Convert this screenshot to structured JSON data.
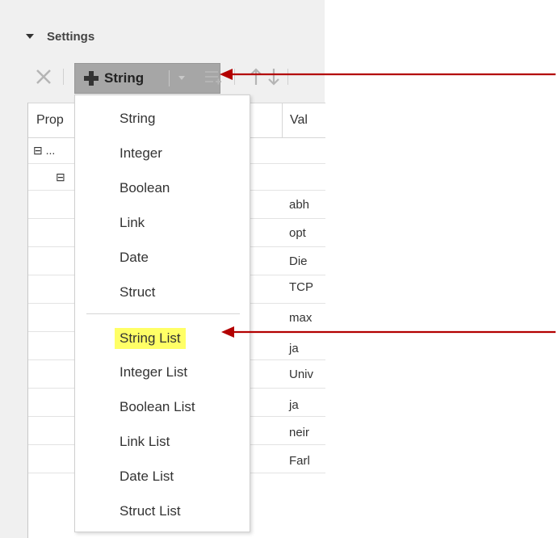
{
  "settings": {
    "title": "Settings"
  },
  "toolbar": {
    "add_label": "String",
    "icons": [
      "delete-icon",
      "plus-icon",
      "dropdown-caret-icon",
      "list-add-icon",
      "arrow-up-icon",
      "arrow-down-icon"
    ]
  },
  "grid": {
    "header": {
      "property": "Prop",
      "value": "Val"
    },
    "tree": {
      "row1": "⊟ ...",
      "row2": "⊟"
    },
    "values": [
      "abh",
      "opt",
      "Die",
      "TCP",
      "max",
      "ja",
      "Univ",
      "ja",
      "neir",
      "Farl"
    ]
  },
  "menu": {
    "items": [
      "String",
      "Integer",
      "Boolean",
      "Link",
      "Date",
      "Struct"
    ],
    "list_items": [
      "String List",
      "Integer List",
      "Boolean List",
      "Link List",
      "Date List",
      "Struct List"
    ],
    "highlighted": "String List"
  },
  "colors": {
    "highlight": "#ffff66",
    "arrow": "#b30000",
    "button_bg": "#a6a6a6"
  }
}
